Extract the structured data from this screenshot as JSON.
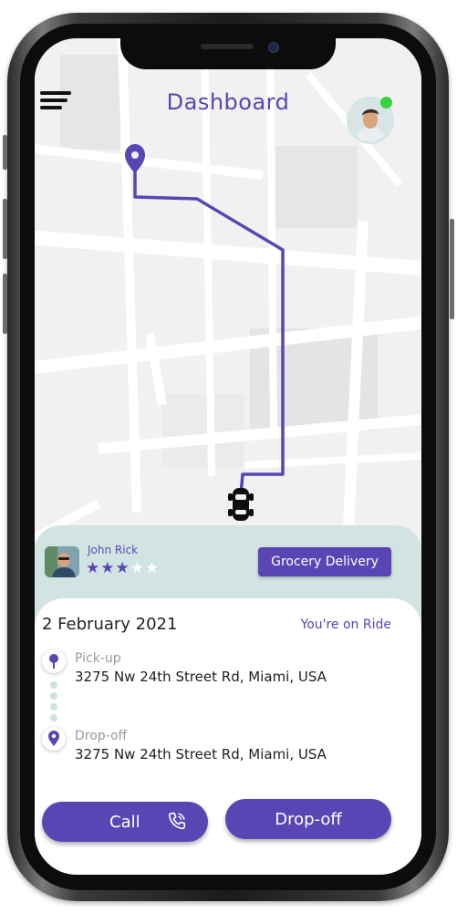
{
  "header": {
    "title": "Dashboard"
  },
  "driver": {
    "name": "John Rick",
    "rating": 3,
    "max_rating": 5
  },
  "service": {
    "label": "Grocery Delivery"
  },
  "ride": {
    "date": "2 February 2021",
    "status": "You're on Ride",
    "pickup": {
      "label": "Pick-up",
      "address": "3275 Nw 24th Street Rd, Miami, USA"
    },
    "dropoff": {
      "label": "Drop-off",
      "address": "3275 Nw 24th Street Rd, Miami, USA"
    }
  },
  "actions": {
    "call_label": "Call",
    "dropoff_label": "Drop-off"
  },
  "colors": {
    "accent": "#5a45b4",
    "online": "#39d23e",
    "panel": "#d2e4e2",
    "map_bg": "#f1f1f1"
  },
  "icons": [
    "menu-icon",
    "location-pin-icon",
    "car-icon",
    "star-icon",
    "phone-icon"
  ]
}
